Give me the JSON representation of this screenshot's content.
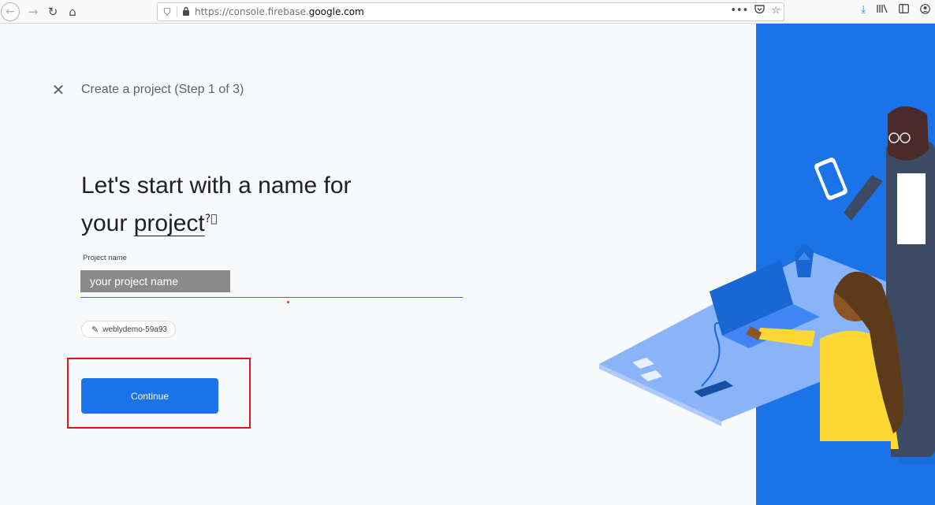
{
  "browser": {
    "back_icon": "arrow-left-icon",
    "forward_icon": "arrow-right-icon",
    "reload_icon": "reload-icon",
    "home_icon": "home-icon",
    "url_prefix": "https://console.firebase.",
    "url_domain": "google.com",
    "page_actions": "•••",
    "toolbar_icons": [
      "download-icon",
      "library-icon",
      "sidebar-icon",
      "account-icon"
    ]
  },
  "dialog": {
    "close_icon": "close-icon",
    "step_title": "Create a project (Step 1 of 3)"
  },
  "main": {
    "headline_line1": "Let's start with a name for",
    "headline_your": "your ",
    "headline_project": "project",
    "help_icon": "help-icon",
    "field_label": "Project name",
    "name_placeholder": "your project name",
    "name_value": "",
    "project_id": "weblydemo-59a93",
    "continue_label": "Continue"
  },
  "colors": {
    "accent": "#1a73e8",
    "highlight": "#e3141c",
    "illustration_bg": "#1a73e8"
  }
}
